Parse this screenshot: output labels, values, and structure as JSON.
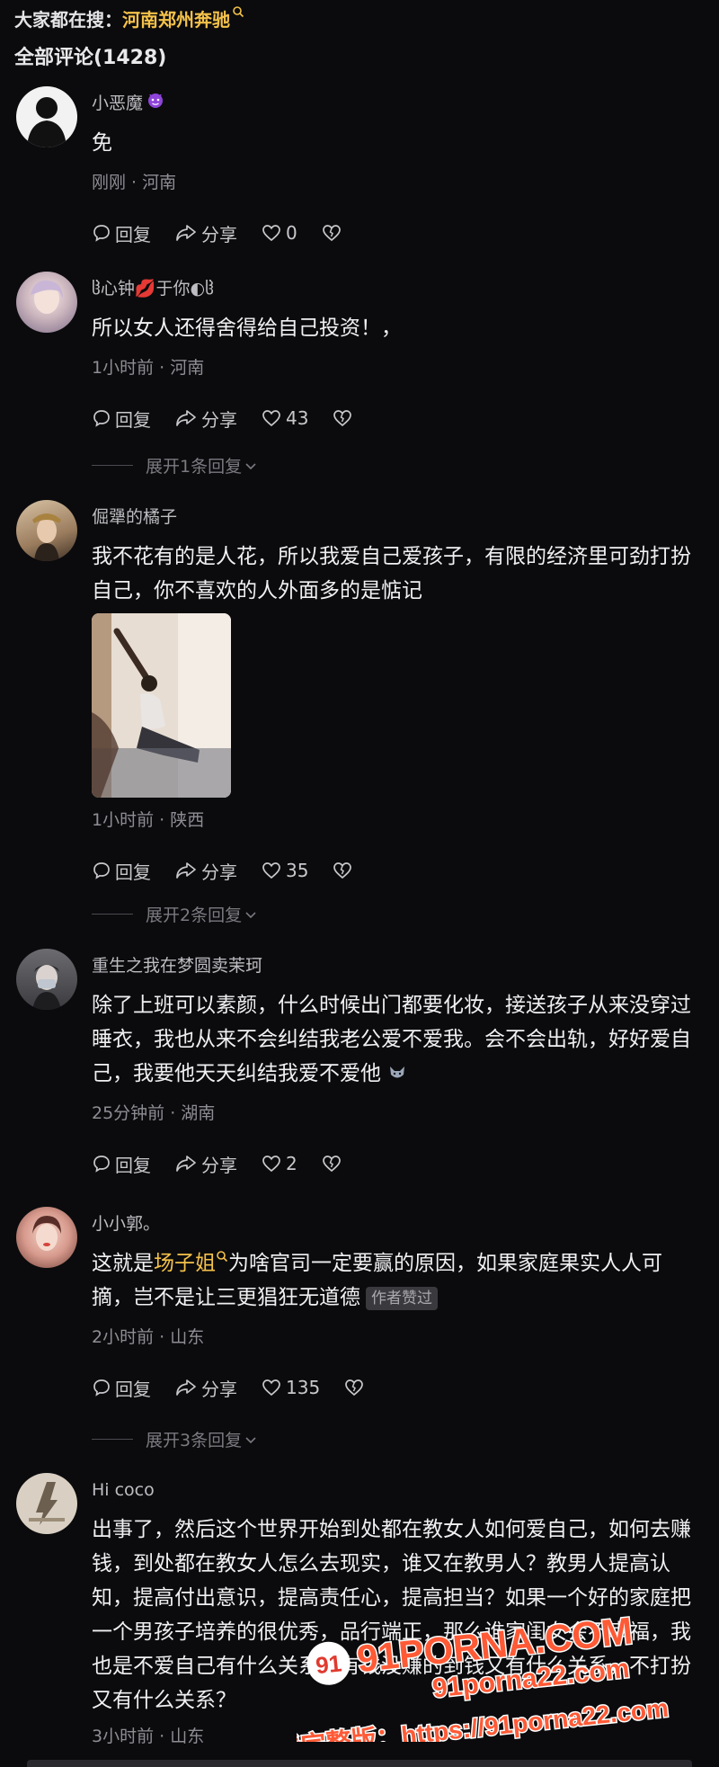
{
  "top_search": {
    "label": "大家都在搜：",
    "term": "河南郑州奔驰"
  },
  "comments_header": {
    "title": "全部评论(1428)"
  },
  "comments": [
    {
      "username": "小恶魔",
      "username_emoji": "😈",
      "text": "免",
      "meta": "刚刚 · 河南",
      "reply_label": "回复",
      "share_label": "分享",
      "like_count": "0"
    },
    {
      "username": "ჱ̒心钟💋于你◐ჱ̒",
      "text": "所以女人还得舍得给自己投资！，",
      "meta": "1小时前 · 河南",
      "reply_label": "回复",
      "share_label": "分享",
      "like_count": "43",
      "expand_label": "展开1条回复"
    },
    {
      "username": "倔犟的橘子",
      "text": "我不花有的是人花，所以我爱自己爱孩子，有限的经济里可劲打扮自己，你不喜欢的人外面多的是惦记",
      "meta": "1小时前 · 陕西",
      "reply_label": "回复",
      "share_label": "分享",
      "like_count": "35",
      "expand_label": "展开2条回复"
    },
    {
      "username": "重生之我在梦圆卖茉珂",
      "text": "除了上班可以素颜，什么时候出门都要化妆，接送孩子从来没穿过睡衣，我也从来不会纠结我老公爱不爱我。会不会出轨，好好爱自己，我要他天天纠结我爱不爱他",
      "text_emoji": "🐺",
      "meta": "25分钟前 · 湖南",
      "reply_label": "回复",
      "share_label": "分享",
      "like_count": "2"
    },
    {
      "username": "小小郭。",
      "text_before": "这就是",
      "text_link": "场子姐",
      "text_after": "为啥官司一定要赢的原因，如果家庭果实人人可摘，岂不是让三更猖狂无道德",
      "badge": "作者赞过",
      "meta": "2小时前 · 山东",
      "reply_label": "回复",
      "share_label": "分享",
      "like_count": "135",
      "expand_label": "展开3条回复"
    },
    {
      "username": "Hi coco",
      "text": "出事了，然后这个世界开始到处都在教女人如何爱自己，如何去赚钱，到处都在教女人怎么去现实，谁又在教男人？教男人提高认知，提高付出意识，提高责任心，提高担当？如果一个好的家庭把一个男孩子培养的很优秀，品行端正，那么谁家闺女会不幸福，我也是不爱自己有什么关系，有钱没赚的到钱又有什么关系，不打扮又有什么关系？",
      "meta": "3小时前 · 山东"
    }
  ],
  "watermark": {
    "logo": "91PORNA.COM",
    "line1": "91porna22.com",
    "line2": "看完整版：https://91porna22.com"
  },
  "colors": {
    "background": "#0b0b0d",
    "accent": "#f4c24a",
    "meta": "#8d8d94"
  },
  "icons": [
    "search-icon",
    "reply-icon",
    "share-icon",
    "like-icon",
    "dislike-icon",
    "chevron-down-icon"
  ]
}
